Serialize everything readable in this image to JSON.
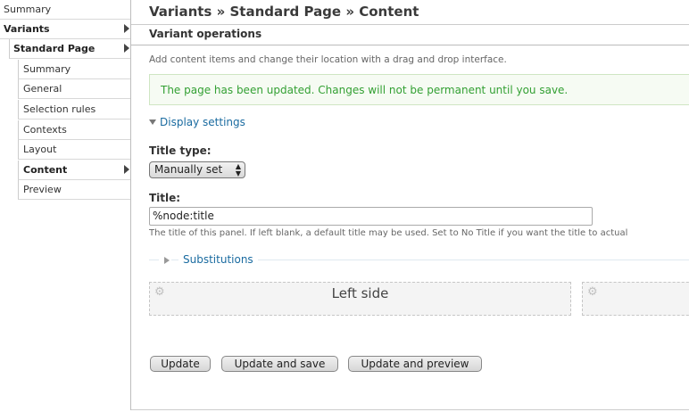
{
  "sidebar": {
    "items": [
      {
        "label": "Summary"
      },
      {
        "label": "Variants"
      },
      {
        "label": "Standard Page"
      },
      {
        "label": "Summary"
      },
      {
        "label": "General"
      },
      {
        "label": "Selection rules"
      },
      {
        "label": "Contexts"
      },
      {
        "label": "Layout"
      },
      {
        "label": "Content"
      },
      {
        "label": "Preview"
      }
    ]
  },
  "header": {
    "breadcrumb": "Variants » Standard Page » Content",
    "section_title": "Variant operations",
    "description": "Add content items and change their location with a drag and drop interface."
  },
  "status_message": "The page has been updated. Changes will not be permanent until you save.",
  "display_settings": {
    "label": "Display settings",
    "title_type_label": "Title type:",
    "title_type_value": "Manually set",
    "title_label": "Title:",
    "title_value": "%node:title",
    "title_help": "The title of this panel. If left blank, a default title may be used. Set to No Title if you want the title to actual",
    "substitutions_label": "Substitutions"
  },
  "regions": [
    {
      "title": "Left side"
    },
    {
      "title": ""
    }
  ],
  "buttons": {
    "update": "Update",
    "update_and_save": "Update and save",
    "update_and_preview": "Update and preview"
  },
  "colors": {
    "status_text": "#33a033",
    "link": "#1a6ba0"
  },
  "icons": {
    "region_settings": "gear-icon",
    "collapsed": "triangle-right-icon",
    "expanded": "triangle-down-icon",
    "nav_active": "arrow-right-icon"
  }
}
